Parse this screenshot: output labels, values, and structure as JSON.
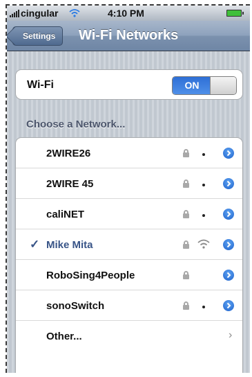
{
  "status_bar": {
    "carrier": "cingular",
    "time": "4:10 PM"
  },
  "nav": {
    "back_label": "Settings",
    "title": "Wi-Fi Networks"
  },
  "wifi": {
    "label": "Wi-Fi",
    "toggle_state": "ON"
  },
  "section_header": "Choose a Network...",
  "networks": [
    {
      "name": "2WIRE26",
      "locked": true,
      "selected": false,
      "signal": "dot"
    },
    {
      "name": "2WIRE 45",
      "locked": true,
      "selected": false,
      "signal": "dot"
    },
    {
      "name": "caliNET",
      "locked": true,
      "selected": false,
      "signal": "dot"
    },
    {
      "name": "Mike Mita",
      "locked": true,
      "selected": true,
      "signal": "wifi"
    },
    {
      "name": "RoboSing4People",
      "locked": true,
      "selected": false,
      "signal": "none"
    },
    {
      "name": "sonoSwitch",
      "locked": true,
      "selected": false,
      "signal": "dot"
    }
  ],
  "other_label": "Other...",
  "colors": {
    "accent": "#2e6fd6",
    "selected_text": "#385487",
    "nav_bar": "#8ea2bd"
  }
}
